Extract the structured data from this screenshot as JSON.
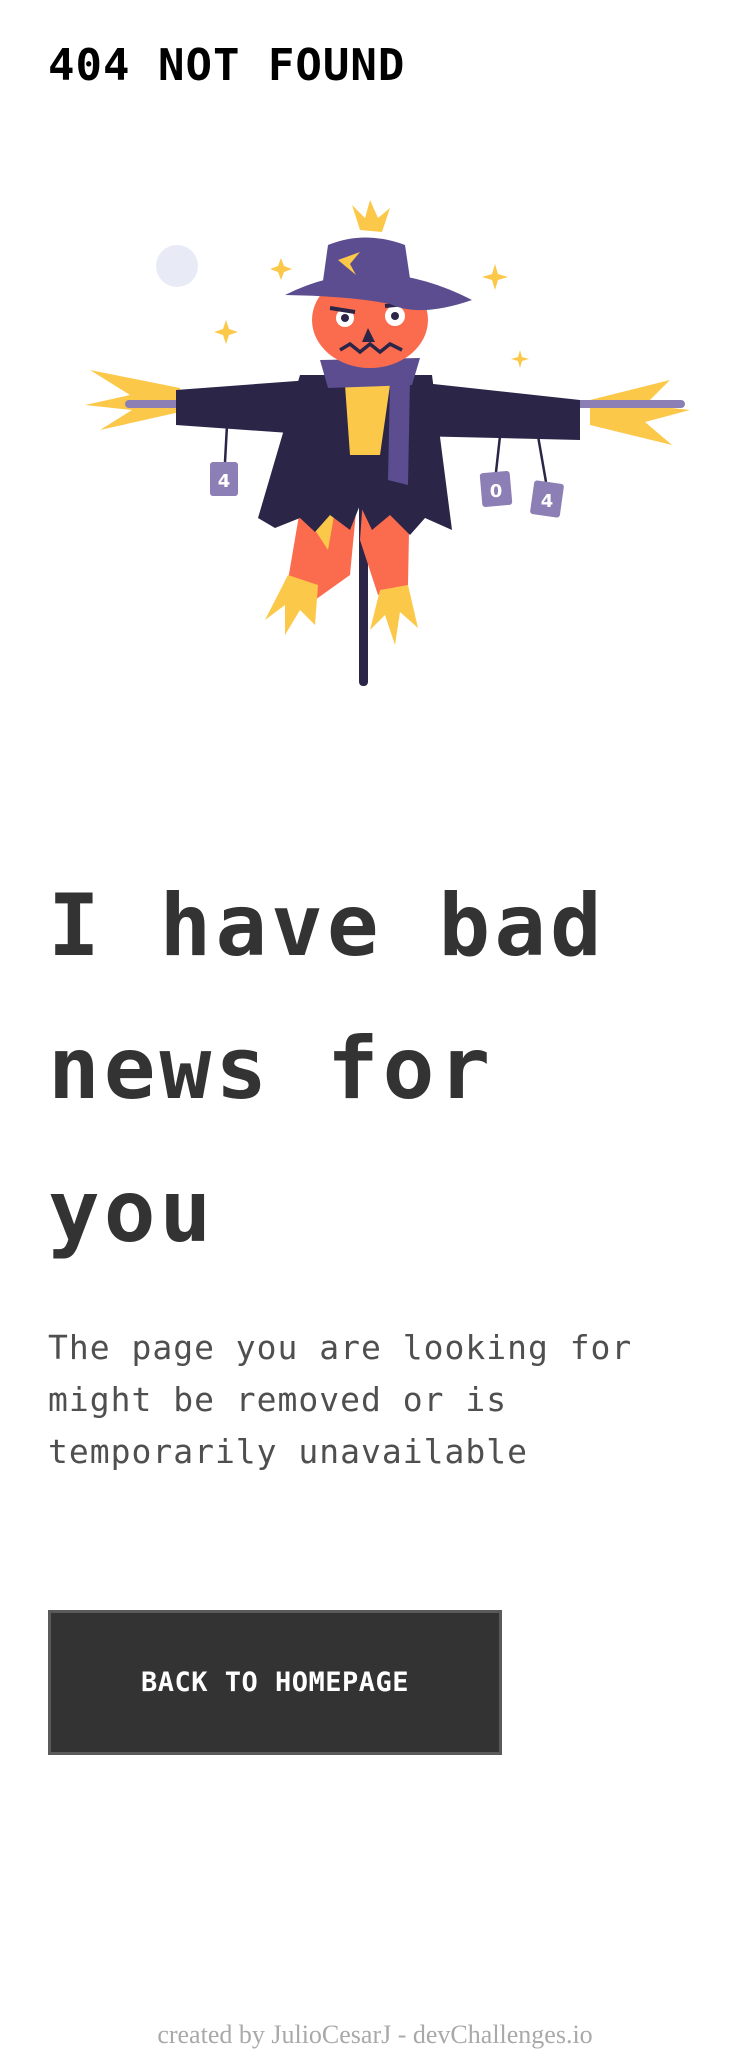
{
  "header": {
    "logo_text": "404 NOT FOUND"
  },
  "illustration": {
    "name": "scarecrow-illustration",
    "can_labels": [
      "4",
      "0",
      "4"
    ],
    "colors": {
      "hat": "#5b4d8f",
      "coat": "#2b2548",
      "face": "#fb6c4f",
      "straw": "#fbc84a",
      "pole": "#2b2548",
      "moon": "#e8eaf6",
      "cans": "#8c7fb5"
    }
  },
  "main": {
    "headline": "I have bad news for you",
    "message": "The page you are looking for might be removed or is temporarily unavailable",
    "cta_label": "BACK TO HOMEPAGE"
  },
  "footer": {
    "credit": "created by JulioCesarJ - devChallenges.io"
  }
}
